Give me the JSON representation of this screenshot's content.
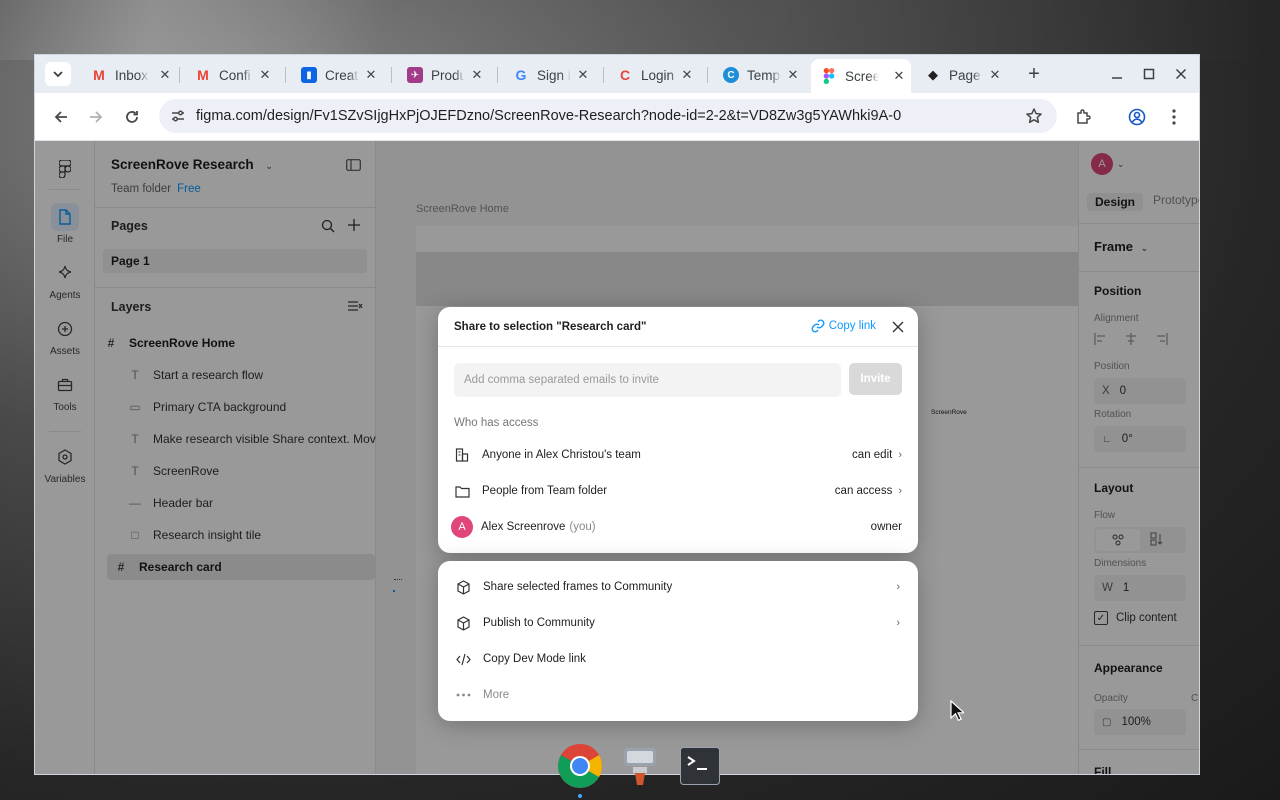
{
  "browser": {
    "tabs": [
      {
        "title": "Inbox",
        "icon": "gmail-icon",
        "color": "#ea4335",
        "glyph": "M"
      },
      {
        "title": "Confi",
        "icon": "gmail-icon",
        "color": "#ea4335",
        "glyph": "M"
      },
      {
        "title": "Creat",
        "icon": "trello-icon",
        "color": "#0c66e4",
        "glyph": "▮"
      },
      {
        "title": "Produ",
        "icon": "rocket-icon",
        "color": "#a23b8a",
        "glyph": "✈"
      },
      {
        "title": "Sign in",
        "icon": "google-icon",
        "color": "#4285f4",
        "glyph": "G"
      },
      {
        "title": "Login",
        "icon": "refresh-logo-icon",
        "color": "#e8453c",
        "glyph": "C"
      },
      {
        "title": "Temp",
        "icon": "canva-icon",
        "color": "#1c8fd6",
        "glyph": "C"
      },
      {
        "title": "Scree",
        "icon": "figma-icon",
        "color": "#f24e1e",
        "glyph": "F"
      },
      {
        "title": "Page",
        "icon": "notion-cube-icon",
        "color": "#222222",
        "glyph": "◆"
      }
    ],
    "url": "figma.com/design/Fv1SZvSIjgHxPjOJEFDzno/ScreenRove-Research?node-id=2-2&t=VD8Zw3g5YAWhki9A-0"
  },
  "figma": {
    "rail": [
      {
        "label": "File",
        "icon": "file-icon"
      },
      {
        "label": "Agents",
        "icon": "sparkle-icon"
      },
      {
        "label": "Assets",
        "icon": "assets-icon"
      },
      {
        "label": "Tools",
        "icon": "toolbox-icon"
      },
      {
        "label": "Variables",
        "icon": "variables-icon"
      }
    ],
    "project": {
      "title": "ScreenRove Research",
      "folder": "Team folder",
      "plan": "Free"
    },
    "pages_label": "Pages",
    "page": "Page 1",
    "layers_label": "Layers",
    "layers": [
      {
        "name": "ScreenRove Home",
        "icon": "#"
      },
      {
        "name": "Start a research flow",
        "icon": "T"
      },
      {
        "name": "Primary CTA background",
        "icon": "▭"
      },
      {
        "name": "Make research visible Share context. Mov",
        "icon": "T"
      },
      {
        "name": "ScreenRove",
        "icon": "T"
      },
      {
        "name": "Header bar",
        "icon": "—"
      },
      {
        "name": "Research insight tile",
        "icon": "□"
      },
      {
        "name": "Research card",
        "icon": "#"
      }
    ],
    "canvas": {
      "frame_label": "ScreenRove Home",
      "tiny_label": "ScreenRove"
    },
    "right": {
      "avatar": "A",
      "tab_design": "Design",
      "tab_prototype": "Prototype",
      "frame": "Frame",
      "position": "Position",
      "alignment": "Alignment",
      "position_label": "Position",
      "x_label": "X",
      "x_value": "0",
      "rotation": "Rotation",
      "rotation_value": "0°",
      "layout": "Layout",
      "flow": "Flow",
      "dimensions": "Dimensions",
      "w_label": "W",
      "w_value": "1",
      "clip": "Clip content",
      "appearance": "Appearance",
      "opacity": "Opacity",
      "opacity_value": "100%",
      "corner_cut": "C",
      "fill": "Fill"
    }
  },
  "share": {
    "title": "Share to selection \"Research card\"",
    "copy_link": "Copy link",
    "email_placeholder": "Add comma separated emails to invite",
    "invite": "Invite",
    "who_has_access": "Who has access",
    "access": [
      {
        "name": "Anyone in Alex Christou's team",
        "role": "can edit",
        "icon": "team-building-icon"
      },
      {
        "name": "People from Team folder",
        "role": "can access",
        "icon": "folder-icon"
      },
      {
        "name": "Alex Screenrove",
        "you": "(you)",
        "role": "owner",
        "avatar": "A"
      }
    ],
    "menu": [
      {
        "label": "Share selected frames to Community",
        "icon": "community-icon"
      },
      {
        "label": "Publish to Community",
        "icon": "community-icon"
      },
      {
        "label": "Copy Dev Mode link",
        "icon": "code-icon"
      },
      {
        "label": "More",
        "icon": "more-icon"
      }
    ]
  },
  "colors": {
    "accent": "#0d99ff",
    "avatar": "#e0467a",
    "figma_red": "#f24e1e"
  }
}
